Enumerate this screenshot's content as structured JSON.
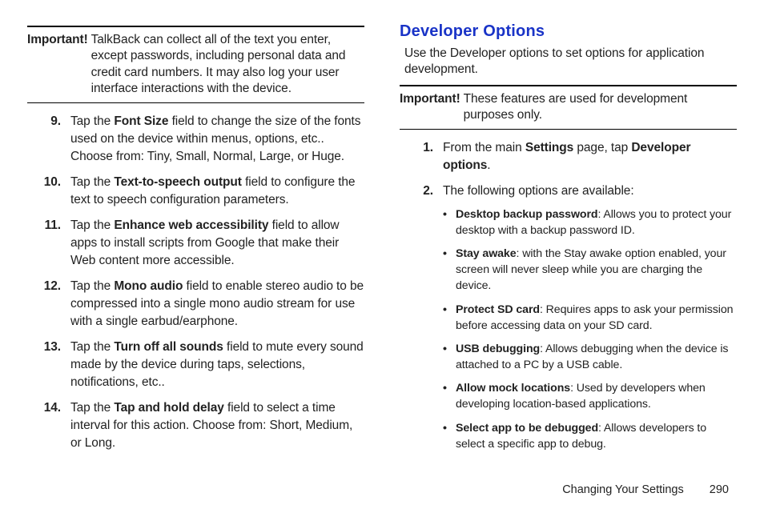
{
  "left": {
    "callout": {
      "lead": "Important!",
      "body": "TalkBack can collect all of the text you enter, except passwords, including personal data and credit card numbers. It may also log your user interface interactions with the device."
    },
    "steps": [
      {
        "n": "9.",
        "pre": "Tap the ",
        "bold": "Font Size",
        "post": " field to change the size of the fonts used on the device within menus, options, etc.. Choose from: Tiny, Small, Normal, Large, or Huge."
      },
      {
        "n": "10.",
        "pre": "Tap the ",
        "bold": "Text-to-speech output",
        "post": " field to configure the text to speech configuration parameters."
      },
      {
        "n": "11.",
        "pre": "Tap the ",
        "bold": "Enhance web accessibility",
        "post": " field to allow apps to install scripts from Google that make their Web content more accessible."
      },
      {
        "n": "12.",
        "pre": "Tap the ",
        "bold": "Mono audio",
        "post": " field to enable stereo audio to be compressed into a single mono audio stream for use with a single earbud/earphone."
      },
      {
        "n": "13.",
        "pre": "Tap the ",
        "bold": "Turn off all sounds",
        "post": " field to mute every sound made by the device during taps, selections, notifications, etc.."
      },
      {
        "n": "14.",
        "pre": "Tap the ",
        "bold": "Tap and hold delay",
        "post": " field to select a time interval for this action. Choose from: Short, Medium, or Long."
      }
    ]
  },
  "right": {
    "heading": "Developer Options",
    "intro": "Use the Developer options to set options for application development.",
    "callout": {
      "lead": "Important!",
      "body": "These features are used for development purposes only."
    },
    "steps": [
      {
        "n": "1.",
        "segments": [
          {
            "t": "From the main "
          },
          {
            "t": "Settings",
            "b": true
          },
          {
            "t": " page, tap "
          },
          {
            "t": "Developer options",
            "b": true
          },
          {
            "t": "."
          }
        ]
      },
      {
        "n": "2.",
        "segments": [
          {
            "t": "The following options are available:"
          }
        ],
        "bullets": [
          {
            "bold": "Desktop backup password",
            "post": ": Allows you to protect your desktop with a backup password ID."
          },
          {
            "bold": "Stay awake",
            "post": ": with the Stay awake option enabled, your screen will never sleep while you are charging the device."
          },
          {
            "bold": "Protect SD card",
            "post": ": Requires apps to ask your permission before accessing data on your SD card."
          },
          {
            "bold": "USB debugging",
            "post": ": Allows debugging when the device is attached to a PC by a USB cable."
          },
          {
            "bold": "Allow mock locations",
            "post": ": Used by developers when developing location-based applications."
          },
          {
            "bold": "Select app to be debugged",
            "post": ": Allows developers to select a specific app to debug."
          }
        ]
      }
    ]
  },
  "footer": {
    "section": "Changing Your Settings",
    "page": "290"
  }
}
